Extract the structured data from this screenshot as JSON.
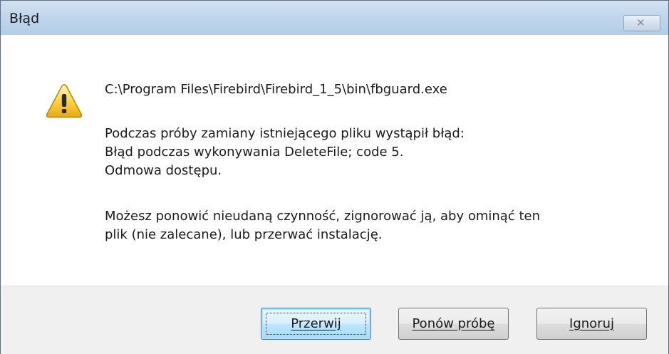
{
  "window": {
    "title": "Błąd",
    "close_label": "✕"
  },
  "dialog": {
    "icon": "warning-icon",
    "path": "C:\\Program Files\\Firebird\\Firebird_1_5\\bin\\fbguard.exe",
    "error_lines": [
      "Podczas próby zamiany istniejącego pliku wystąpił błąd:",
      "Błąd podczas wykonywania DeleteFile; code 5.",
      "Odmowa dostępu."
    ],
    "hint_lines": [
      "Możesz ponowić nieudaną czynność, zignorować ją, aby ominąć ten",
      "plik (nie zalecane), lub przerwać instalację."
    ]
  },
  "buttons": {
    "abort": "Przerwij",
    "retry": "Ponów próbę",
    "ignore": "Ignoruj"
  }
}
